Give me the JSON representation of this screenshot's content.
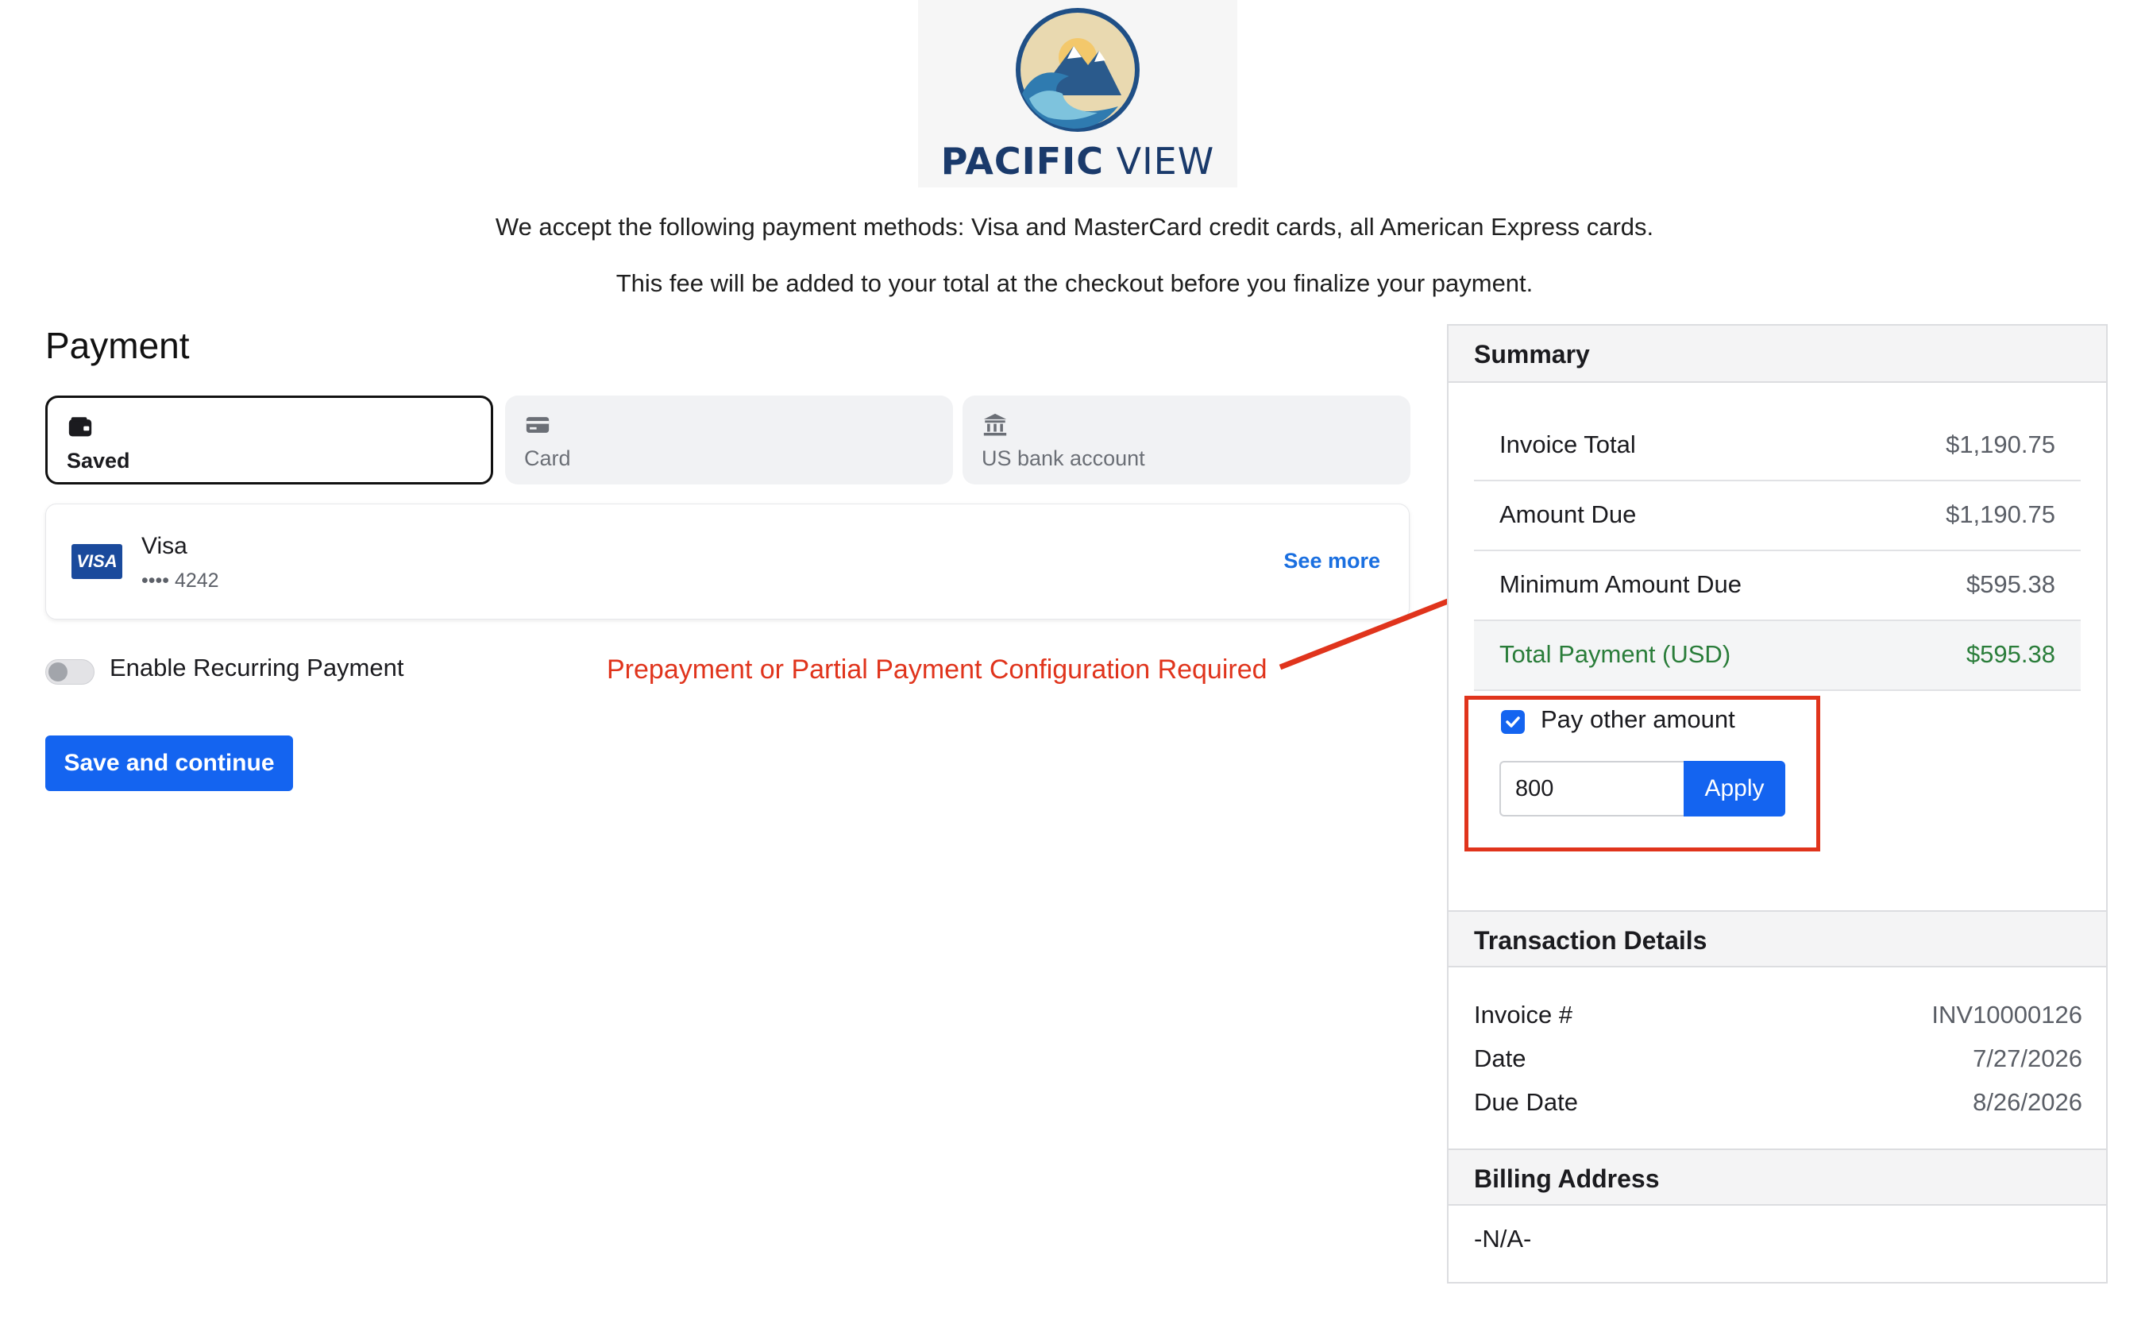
{
  "brand": {
    "name_bold": "PACIFIC",
    "name_light": "VIEW"
  },
  "notices": [
    "We accept the following payment methods: Visa and MasterCard credit cards, all American Express cards.",
    "This fee will be added to your total at the checkout before you finalize your payment."
  ],
  "payment": {
    "title": "Payment",
    "tabs": [
      {
        "label": "Saved",
        "icon": "wallet-icon",
        "active": true
      },
      {
        "label": "Card",
        "icon": "credit-card-icon",
        "active": false
      },
      {
        "label": "US bank account",
        "icon": "bank-icon",
        "active": false
      }
    ],
    "saved_card": {
      "brand_logo": "VISA",
      "name": "Visa",
      "last4": "•••• 4242",
      "see_more": "See more"
    },
    "recurring_label": "Enable Recurring Payment",
    "recurring_enabled": false,
    "save_button": "Save and continue"
  },
  "annotation": {
    "text": "Prepayment or Partial Payment Configuration Required",
    "color": "#e0341c"
  },
  "summary": {
    "title": "Summary",
    "rows": [
      {
        "label": "Invoice Total",
        "value": "$1,190.75"
      },
      {
        "label": "Amount Due",
        "value": "$1,190.75"
      },
      {
        "label": "Minimum Amount Due",
        "value": "$595.38"
      },
      {
        "label": "Total Payment (USD)",
        "value": "$595.38"
      }
    ],
    "pay_other_label": "Pay other amount",
    "pay_other_checked": true,
    "other_amount_value": "800",
    "apply_button": "Apply"
  },
  "transaction": {
    "title": "Transaction Details",
    "rows": [
      {
        "label": "Invoice #",
        "value": "INV10000126"
      },
      {
        "label": "Date",
        "value": "7/27/2026"
      },
      {
        "label": "Due Date",
        "value": "8/26/2026"
      }
    ]
  },
  "billing": {
    "title": "Billing Address",
    "value": "-N/A-"
  },
  "colors": {
    "accent": "#1464f0",
    "total_green": "#2a7d3a",
    "annotation_red": "#e0341c"
  }
}
